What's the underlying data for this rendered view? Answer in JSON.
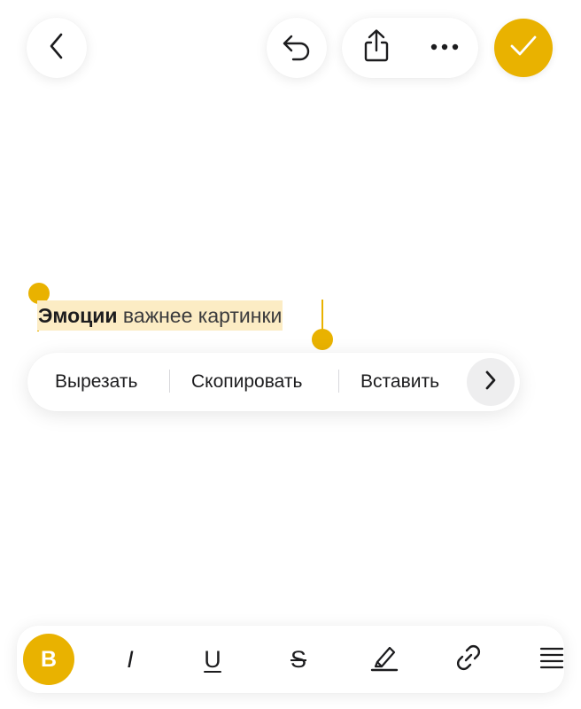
{
  "header": {
    "back_icon": "chevron-left-icon",
    "undo_icon": "undo-arrow-icon",
    "share_icon": "share-icon",
    "more_icon": "more-dots-icon",
    "done_icon": "checkmark-icon"
  },
  "note": {
    "bold_word": "Эмоции",
    "rest_text": " важнее картинки"
  },
  "context_menu": {
    "items": [
      "Вырезать",
      "Скопировать",
      "Вставить"
    ],
    "more_icon": "chevron-right-icon"
  },
  "format_toolbar": {
    "bold_label": "B",
    "italic_label": "I",
    "underline_label": "U",
    "strike_label": "S",
    "highlight_icon": "highlighter-pen-icon",
    "link_icon": "link-icon",
    "list_icon": "list-icon"
  },
  "colors": {
    "accent": "#e9b200",
    "selection": "#fcecc4",
    "background": "#ffffff"
  }
}
